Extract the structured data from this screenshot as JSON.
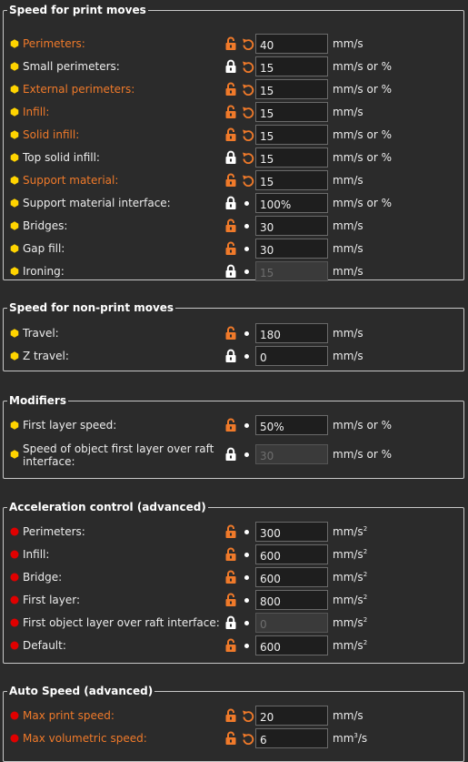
{
  "colors": {
    "background": "#2b2b2b",
    "modified_text": "#f07a2a",
    "lock_open": "#f07a2a",
    "lock_closed": "#ffffff",
    "dot_yellow": "#ffd400",
    "dot_red": "#e00000"
  },
  "groups": [
    {
      "title": "Speed for print moves",
      "rows": [
        {
          "label": "Perimeters:",
          "modified": true,
          "dot": "yellow",
          "lock": "open",
          "reset": "undo",
          "value": "40",
          "disabled": false,
          "unit": "mm/s"
        },
        {
          "label": "Small perimeters:",
          "modified": false,
          "dot": "yellow",
          "lock": "closed",
          "reset": "undo",
          "value": "15",
          "disabled": false,
          "unit": "mm/s or %"
        },
        {
          "label": "External perimeters:",
          "modified": true,
          "dot": "yellow",
          "lock": "open",
          "reset": "undo",
          "value": "15",
          "disabled": false,
          "unit": "mm/s or %"
        },
        {
          "label": "Infill:",
          "modified": true,
          "dot": "yellow",
          "lock": "open",
          "reset": "undo",
          "value": "15",
          "disabled": false,
          "unit": "mm/s"
        },
        {
          "label": "Solid infill:",
          "modified": true,
          "dot": "yellow",
          "lock": "open",
          "reset": "undo",
          "value": "15",
          "disabled": false,
          "unit": "mm/s or %"
        },
        {
          "label": "Top solid infill:",
          "modified": false,
          "dot": "yellow",
          "lock": "closed",
          "reset": "undo",
          "value": "15",
          "disabled": false,
          "unit": "mm/s or %"
        },
        {
          "label": "Support material:",
          "modified": true,
          "dot": "yellow",
          "lock": "open",
          "reset": "undo",
          "value": "15",
          "disabled": false,
          "unit": "mm/s"
        },
        {
          "label": "Support material interface:",
          "modified": false,
          "dot": "yellow",
          "lock": "closed",
          "reset": "bullet",
          "value": "100%",
          "disabled": false,
          "unit": "mm/s or %"
        },
        {
          "label": "Bridges:",
          "modified": false,
          "dot": "yellow",
          "lock": "open",
          "reset": "bullet",
          "value": "30",
          "disabled": false,
          "unit": "mm/s"
        },
        {
          "label": "Gap fill:",
          "modified": false,
          "dot": "yellow",
          "lock": "open",
          "reset": "bullet",
          "value": "30",
          "disabled": false,
          "unit": "mm/s"
        },
        {
          "label": "Ironing:",
          "modified": false,
          "dot": "yellow",
          "lock": "closed",
          "reset": "bullet",
          "value": "15",
          "disabled": true,
          "unit": "mm/s"
        }
      ]
    },
    {
      "title": "Speed for non-print moves",
      "rows": [
        {
          "label": "Travel:",
          "modified": false,
          "dot": "yellow",
          "lock": "open",
          "reset": "bullet",
          "value": "180",
          "disabled": false,
          "unit": "mm/s"
        },
        {
          "label": "Z travel:",
          "modified": false,
          "dot": "yellow",
          "lock": "closed",
          "reset": "bullet",
          "value": "0",
          "disabled": false,
          "unit": "mm/s"
        }
      ]
    },
    {
      "title": "Modifiers",
      "rows": [
        {
          "label": "First layer speed:",
          "modified": false,
          "dot": "yellow",
          "lock": "open",
          "reset": "bullet",
          "value": "50%",
          "disabled": false,
          "unit": "mm/s or %"
        },
        {
          "label": "Speed of object first layer over raft interface:",
          "modified": false,
          "dot": "yellow",
          "lock": "closed",
          "reset": "bullet",
          "value": "30",
          "disabled": true,
          "unit": "mm/s or %",
          "two_line": true
        }
      ]
    },
    {
      "title": "Acceleration control (advanced)",
      "rows": [
        {
          "label": "Perimeters:",
          "modified": false,
          "dot": "red",
          "lock": "open",
          "reset": "bullet",
          "value": "300",
          "disabled": false,
          "unit": "mm/s",
          "unit_sup": "2"
        },
        {
          "label": "Infill:",
          "modified": false,
          "dot": "red",
          "lock": "open",
          "reset": "bullet",
          "value": "600",
          "disabled": false,
          "unit": "mm/s",
          "unit_sup": "2"
        },
        {
          "label": "Bridge:",
          "modified": false,
          "dot": "red",
          "lock": "open",
          "reset": "bullet",
          "value": "600",
          "disabled": false,
          "unit": "mm/s",
          "unit_sup": "2"
        },
        {
          "label": "First layer:",
          "modified": false,
          "dot": "red",
          "lock": "open",
          "reset": "bullet",
          "value": "800",
          "disabled": false,
          "unit": "mm/s",
          "unit_sup": "2"
        },
        {
          "label": "First object layer over raft interface:",
          "modified": false,
          "dot": "red",
          "lock": "closed",
          "reset": "bullet",
          "value": "0",
          "disabled": true,
          "unit": "mm/s",
          "unit_sup": "2"
        },
        {
          "label": "Default:",
          "modified": false,
          "dot": "red",
          "lock": "open",
          "reset": "bullet",
          "value": "600",
          "disabled": false,
          "unit": "mm/s",
          "unit_sup": "2"
        }
      ]
    },
    {
      "title": "Auto Speed (advanced)",
      "rows": [
        {
          "label": "Max print speed:",
          "modified": true,
          "dot": "red",
          "lock": "open",
          "reset": "undo",
          "value": "20",
          "disabled": false,
          "unit": "mm/s"
        },
        {
          "label": "Max volumetric speed:",
          "modified": true,
          "dot": "red",
          "lock": "open",
          "reset": "undo",
          "value": "6",
          "disabled": false,
          "unit": "mm",
          "unit_sup": "3",
          "unit_suffix": "/s"
        }
      ]
    }
  ]
}
